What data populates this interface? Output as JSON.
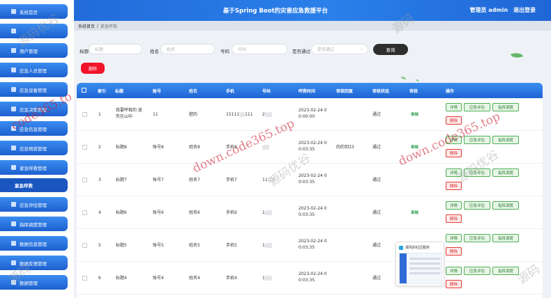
{
  "header": {
    "title": "基于Spring Boot的灾害应急救援平台",
    "user_text": "管理员 admin",
    "logout": "退出登录"
  },
  "sidebar": {
    "items": [
      {
        "label": "系统首页"
      },
      {
        "label": ""
      },
      {
        "label": "用户管理"
      },
      {
        "label": "应急人员管理"
      },
      {
        "label": "应急设备管理"
      },
      {
        "label": "应急决策管理"
      },
      {
        "label": "应急信息管理"
      },
      {
        "label": "应急物资管理"
      },
      {
        "label": "紧急呼救管理"
      }
    ],
    "active_sub": "紧急呼救",
    "items_after": [
      {
        "label": "应急评估管理"
      },
      {
        "label": "指挥调度管理"
      },
      {
        "label": "数据信息管理"
      },
      {
        "label": "数据反馈管理"
      },
      {
        "label": "数据管理"
      }
    ]
  },
  "breadcrumb": {
    "home": "系统首页",
    "separator": "/",
    "current": "紧急呼救"
  },
  "search": {
    "title_label": "标题",
    "title_placeholder": "标题",
    "name_label": "姓名",
    "name_placeholder": "姓名",
    "number_label": "号码",
    "number_placeholder": "号码",
    "approved_label": "是否通过",
    "approved_placeholder": "是否通过",
    "query_button": "查询"
  },
  "actions": {
    "delete_button": "删除"
  },
  "table": {
    "headers": [
      "索引",
      "标题",
      "账号",
      "姓名",
      "手机",
      "号码",
      "呼救时间",
      "审核回复",
      "审核状态",
      "审核",
      "操作"
    ],
    "rows": [
      {
        "index": "1",
        "title_line1": "我要呼救的 迷",
        "title_line2": "失在山中",
        "account": "11",
        "name": "肥的",
        "phone": "15111",
        "phone_tail": "111",
        "number": "2",
        "time_line1": "2023-02-24 0",
        "time_line2": "0:00:00",
        "reply": "",
        "status": "通过",
        "audit": "审核"
      },
      {
        "index": "2",
        "title_line1": "标题8",
        "title_line2": "",
        "account": "账号8",
        "name": "姓名8",
        "phone": "手机8",
        "phone_tail": "",
        "number": "",
        "time_line1": "2023-02-24 0",
        "time_line2": "0:03:35",
        "reply": "的的到33",
        "status": "通过",
        "audit": "审核"
      },
      {
        "index": "3",
        "title_line1": "标题7",
        "title_line2": "",
        "account": "账号7",
        "name": "姓名7",
        "phone": "手机7",
        "phone_tail": "",
        "number": "11",
        "time_line1": "2023-02-24 0",
        "time_line2": "0:03:35",
        "reply": "",
        "status": "通过",
        "audit": ""
      },
      {
        "index": "4",
        "title_line1": "标题6",
        "title_line2": "",
        "account": "账号6",
        "name": "姓名6",
        "phone": "手机6",
        "phone_tail": "",
        "number": "1",
        "time_line1": "2023-02-24 0",
        "time_line2": "0:03:35",
        "reply": "",
        "status": "通过",
        "audit": "审核"
      },
      {
        "index": "5",
        "title_line1": "标题5",
        "title_line2": "",
        "account": "账号5",
        "name": "姓名5",
        "phone": "手机5",
        "phone_tail": "",
        "number": "1",
        "time_line1": "2023-02-24 0",
        "time_line2": "0:03:35",
        "reply": "",
        "status": "通过",
        "audit": ""
      },
      {
        "index": "6",
        "title_line1": "标题4",
        "title_line2": "",
        "account": "账号4",
        "name": "姓名4",
        "phone": "手机4",
        "phone_tail": "",
        "number": "1",
        "time_line1": "2023-02-24 0",
        "time_line2": "0:03:35",
        "reply": "",
        "status": "通过",
        "audit": ""
      }
    ],
    "op_buttons": {
      "detail": "详情",
      "assess": "应急评估",
      "dispatch": "指挥调度",
      "delete": "删除"
    }
  },
  "popup": {
    "title": "漫风的社区服务"
  },
  "watermarks": {
    "url_text": "down.code365.top",
    "url_short": "code365.to",
    "site_text": "源码优谷",
    "site_short": "源码"
  },
  "colors": {
    "primary": "#1f66d6",
    "danger": "#f2142a",
    "query": "#2e2e2e",
    "success": "#4caf50"
  }
}
